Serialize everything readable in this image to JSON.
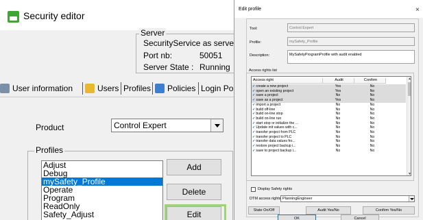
{
  "main": {
    "title": "Security editor",
    "server": {
      "legend": "Server",
      "name": "SecurityService as server",
      "port_label": "Port nb:",
      "port_value": "50051",
      "state_label": "Server State :",
      "state_value": "Running"
    },
    "tabs": [
      {
        "label": "User information"
      },
      {
        "label": "Users"
      },
      {
        "label": "Profiles"
      },
      {
        "label": "Policies"
      },
      {
        "label": "Login Poli"
      }
    ],
    "product": {
      "label": "Product",
      "value": "Control Expert"
    },
    "profiles": {
      "legend": "Profiles",
      "items": [
        "Adjust",
        "Debug",
        "mySafety_Profile",
        "Operate",
        "Program",
        "ReadOnly",
        "Safety_Adjust"
      ],
      "selected": "mySafety_Profile"
    },
    "buttons": {
      "add": "Add",
      "delete": "Delete",
      "edit": "Edit"
    }
  },
  "dialog": {
    "title": "Edit profile",
    "close": "×",
    "tool_label": "Tool:",
    "tool_value": "Control Expert",
    "profile_label": "Profile:",
    "profile_value": "mySafety_Profile",
    "description_label": "Description:",
    "description_value": "MySafetyProgramProfile with audit enabled",
    "access_rights": {
      "legend": "Access rights list",
      "columns": [
        "Access right",
        "Audit",
        "Confirm"
      ],
      "rows": [
        {
          "name": "create a new project",
          "audit": "Yes",
          "confirm": "No",
          "shaded": true
        },
        {
          "name": "open an existing project",
          "audit": "Yes",
          "confirm": "No",
          "shaded": true
        },
        {
          "name": "save a project",
          "audit": "No",
          "confirm": "No",
          "shaded": true
        },
        {
          "name": "save as a project",
          "audit": "Yes",
          "confirm": "No",
          "shaded": true
        },
        {
          "name": "import a project",
          "audit": "No",
          "confirm": "No",
          "shaded": false
        },
        {
          "name": "build off-line",
          "audit": "No",
          "confirm": "No",
          "shaded": false
        },
        {
          "name": "build on-line stop",
          "audit": "No",
          "confirm": "No",
          "shaded": false
        },
        {
          "name": "build on-line run",
          "audit": "No",
          "confirm": "No",
          "shaded": false
        },
        {
          "name": "start stop or initialize the ...",
          "audit": "No",
          "confirm": "No",
          "shaded": false
        },
        {
          "name": "Update init values with c...",
          "audit": "No",
          "confirm": "No",
          "shaded": false
        },
        {
          "name": "transfer project from PLC",
          "audit": "No",
          "confirm": "No",
          "shaded": false
        },
        {
          "name": "transfer project to PLC",
          "audit": "No",
          "confirm": "No",
          "shaded": false
        },
        {
          "name": "transfer data values fro...",
          "audit": "No",
          "confirm": "No",
          "shaded": false
        },
        {
          "name": "restore project backup i...",
          "audit": "No",
          "confirm": "No",
          "shaded": false
        },
        {
          "name": "save to project backup i...",
          "audit": "No",
          "confirm": "No",
          "shaded": false
        }
      ]
    },
    "display_safety_label": "Display Safety rights",
    "dtm_label": "DTM access rights:",
    "dtm_value": "PlanningEngineer",
    "buttons": {
      "state": "State On/Off",
      "audit": "Audit Yes/No",
      "confirm": "Confirm Yes/No",
      "ok": "OK",
      "cancel": "Cancel"
    }
  }
}
